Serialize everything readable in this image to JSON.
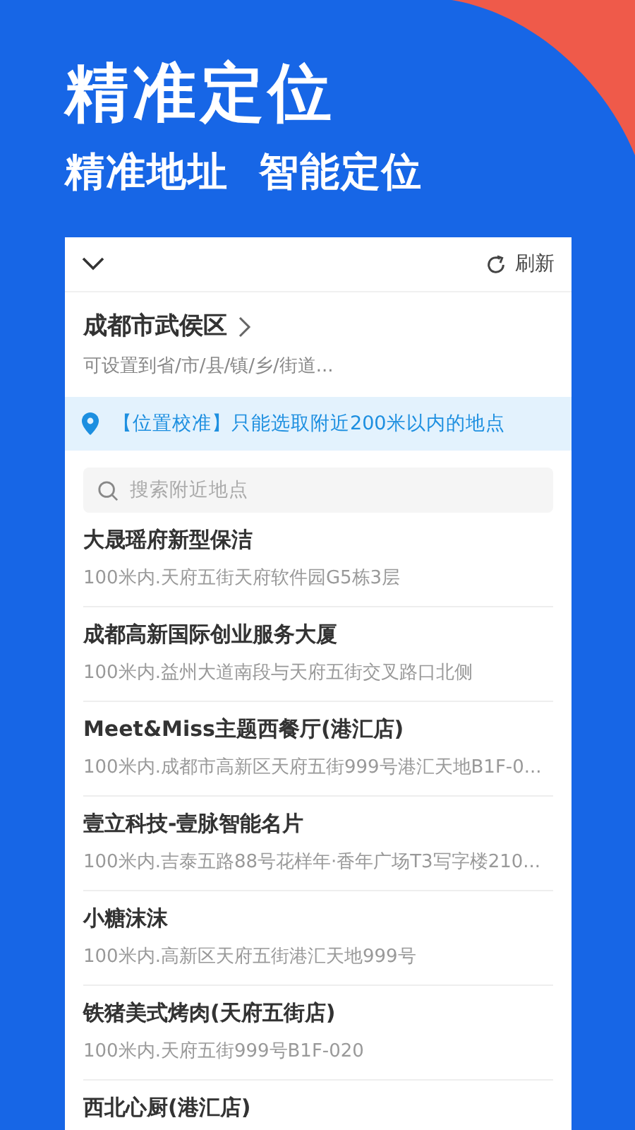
{
  "header": {
    "title": "精准定位",
    "subtitle": "精准地址  智能定位"
  },
  "card": {
    "refresh": "刷新",
    "city": "成都市武侯区",
    "city_hint": "可设置到省/市/县/镇/乡/街道...",
    "notice": "【位置校准】只能选取附近200米以内的地点",
    "search": {
      "placeholder": "搜索附近地点"
    },
    "places": [
      {
        "name": "大晟瑶府新型保洁",
        "address": "100米内.天府五街天府软件园G5栋3层"
      },
      {
        "name": "成都高新国际创业服务大厦",
        "address": "100米内.益州大道南段与天府五街交叉路口北侧"
      },
      {
        "name": "Meet&Miss主题西餐厅(港汇店)",
        "address": "100米内.成都市高新区天府五街999号港汇天地B1F-0..."
      },
      {
        "name": "壹立科技-壹脉智能名片",
        "address": "100米内.吉泰五路88号花样年·香年广场T3写字楼210..."
      },
      {
        "name": "小糖沫沫",
        "address": "100米内.高新区天府五街港汇天地999号"
      },
      {
        "name": "铁猪美式烤肉(天府五街店)",
        "address": "100米内.天府五街999号B1F-020"
      },
      {
        "name": "西北心厨(港汇店)"
      }
    ]
  }
}
